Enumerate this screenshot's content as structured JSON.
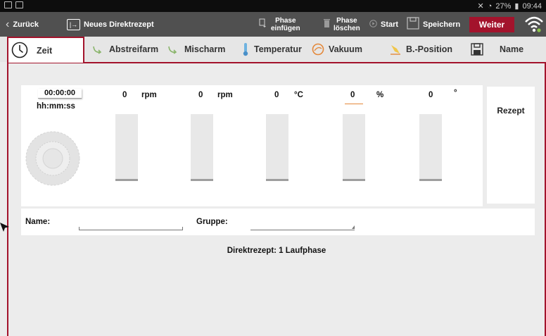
{
  "statusbar": {
    "battery": "27%",
    "time": "09:44"
  },
  "toolbar": {
    "back_label": "Zurück",
    "new_box": "|→",
    "new_label": "Neues Direktrezept",
    "insert_line1": "Phase",
    "insert_line2": "einfügen",
    "delete_line1": "Phase",
    "delete_line2": "löschen",
    "start_label": "Start",
    "save_label": "Speichern",
    "next_label": "Weiter"
  },
  "tabs": [
    {
      "label": "Zeit",
      "active": true
    },
    {
      "label": "Abstreifarm"
    },
    {
      "label": "Mischarm"
    },
    {
      "label": "Temperatur"
    },
    {
      "label": "Vakuum"
    },
    {
      "label": "B.-Position"
    },
    {
      "label": "Name"
    }
  ],
  "phase": {
    "time_value": "00:00:00",
    "time_unit": "hh:mm:ss",
    "columns": [
      {
        "value": "0",
        "unit": "rpm"
      },
      {
        "value": "0",
        "unit": "rpm"
      },
      {
        "value": "0",
        "unit": "°C"
      },
      {
        "value": "0",
        "unit": "%"
      },
      {
        "value": "0",
        "unit": "°"
      }
    ],
    "rezept_label": "Rezept"
  },
  "form": {
    "name_label": "Name:",
    "name_value": "",
    "group_label": "Gruppe:",
    "group_value": ""
  },
  "summary": "Direktrezept: 1 Laufphase",
  "colors": {
    "accent": "#a3132c",
    "toolbar": "#505050",
    "wifi": "#8bc34a"
  }
}
